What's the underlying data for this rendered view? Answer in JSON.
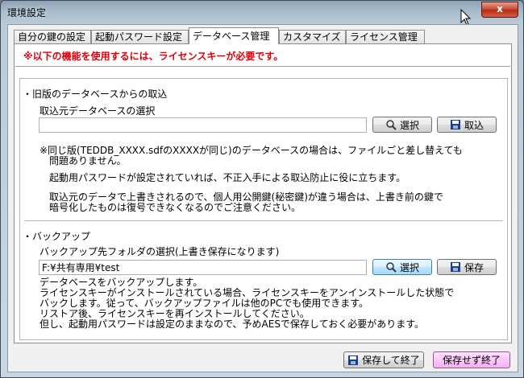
{
  "window": {
    "title": "環境設定",
    "close_label": "x"
  },
  "tabs": [
    {
      "label": "自分の鍵の設定",
      "active": false
    },
    {
      "label": "起動パスワード設定",
      "active": false
    },
    {
      "label": "データベース管理",
      "active": true
    },
    {
      "label": "カスタマイズ",
      "active": false
    },
    {
      "label": "ライセンス管理",
      "active": false
    }
  ],
  "warning": "※以下の機能を使用するには、ライセンスキーが必要です。",
  "import_section": {
    "title": "・旧版のデータベースからの取込",
    "source_label": "取込元データベースの選択",
    "source_value": "",
    "select_button": "選択",
    "import_button": "取込",
    "notes": [
      "※同じ版(TEDDB_XXXX.sdfのXXXXが同じ)のデータベースの場合は、ファイルごと差し替えても",
      "問題ありません。",
      "起動用パスワードが設定されていれば、不正入手による取込防止に役に立ちます。",
      "取込元のデータで上書きされるので、個人用公開鍵(秘密鍵)が違う場合は、上書き前の鍵で",
      "暗号化したものは復号できなくなるのでご注意ください。"
    ]
  },
  "backup_section": {
    "title": "・バックアップ",
    "dest_label": "バックアップ先フォルダの選択(上書き保存になります)",
    "dest_value": "F:¥共有専用¥test",
    "select_button": "選択",
    "save_button": "保存",
    "notes": [
      "データベースをバックアップします。",
      "ライセンスキーがインストールされている場合、ライセンスキーをアンインストールした状態で",
      "バックします。従って、バックアップファイルは他のPCでも使用できます。",
      "リストア後、ライセンスキーを再インストールしてください。",
      "但し、起動用パスワードは設定のままなので、予めAESで保存しておく必要があります。"
    ]
  },
  "footer": {
    "save_exit_button": "保存して終了",
    "exit_without_save_button": "保存せず終了"
  }
}
